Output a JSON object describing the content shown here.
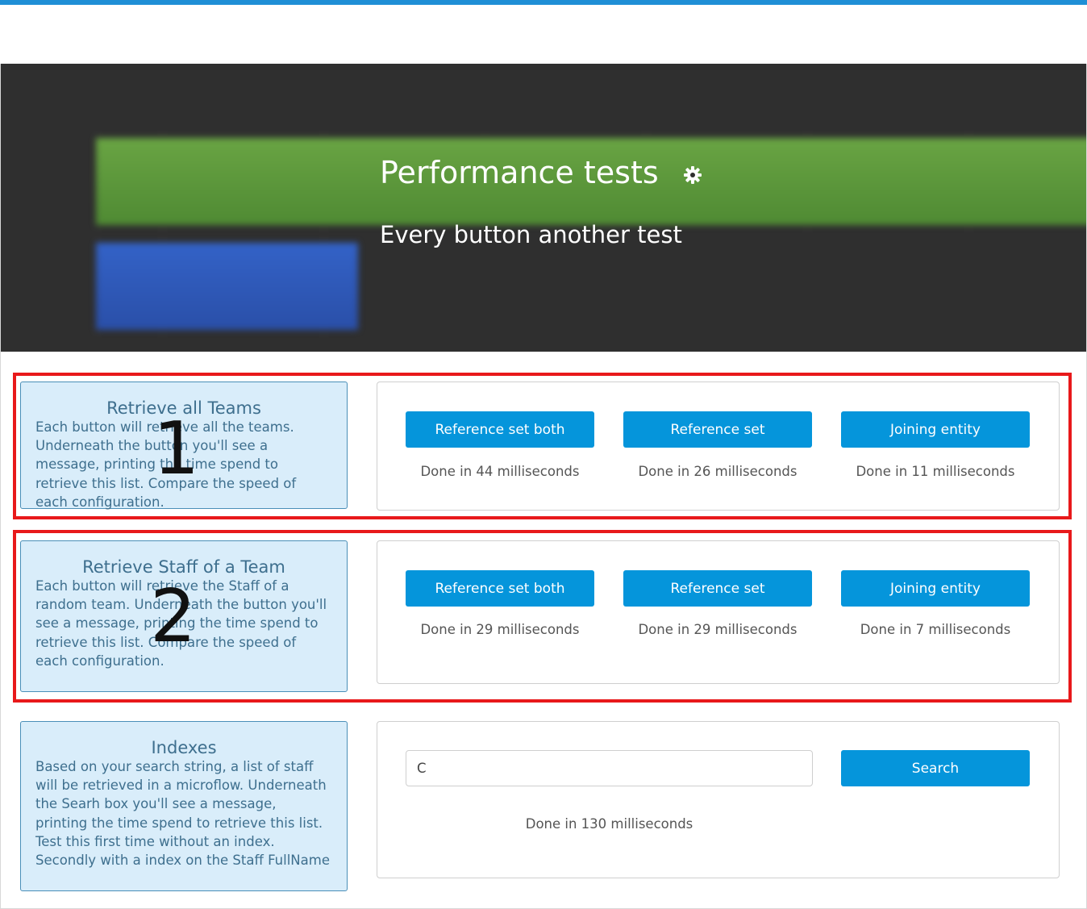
{
  "hero": {
    "title": "Performance tests",
    "subtitle": "Every button another test",
    "gear_icon": "gear-icon"
  },
  "sections": [
    {
      "number": "1",
      "info_title": "Retrieve all Teams",
      "info_text": "Each button will retrieve all the teams. Underneath the button you'll see a message, printing the time spend to retrieve this list. Compare the speed of each configuration.",
      "buttons": [
        {
          "label": "Reference set both",
          "result": "Done in 44 milliseconds"
        },
        {
          "label": "Reference set",
          "result": "Done in 26 milliseconds"
        },
        {
          "label": "Joining entity",
          "result": "Done in 11 milliseconds"
        }
      ]
    },
    {
      "number": "2",
      "info_title": "Retrieve Staff of a Team",
      "info_text": "Each button will retrieve the Staff of a random team. Underneath the button you'll see a message, printing the time spend to retrieve this list. Compare the speed of each configuration.",
      "buttons": [
        {
          "label": "Reference set both",
          "result": "Done in 29 milliseconds"
        },
        {
          "label": "Reference set",
          "result": "Done in 29 milliseconds"
        },
        {
          "label": "Joining entity",
          "result": "Done in 7 milliseconds"
        }
      ]
    }
  ],
  "indexes": {
    "info_title": "Indexes",
    "info_text": "Based on your search string, a list of staff will be retrieved in a microflow. Underneath the Searh box you'll see a message, printing the time spend to retrieve this list. Test this first time without an index. Secondly with a index on the Staff FullName",
    "search_value": "C",
    "search_button": "Search",
    "result": "Done in 130 milliseconds"
  },
  "colors": {
    "accent": "#0595db",
    "highlight_border": "#e8191b",
    "info_card_bg": "#d9edfa",
    "info_card_text": "#3e6f8e"
  }
}
